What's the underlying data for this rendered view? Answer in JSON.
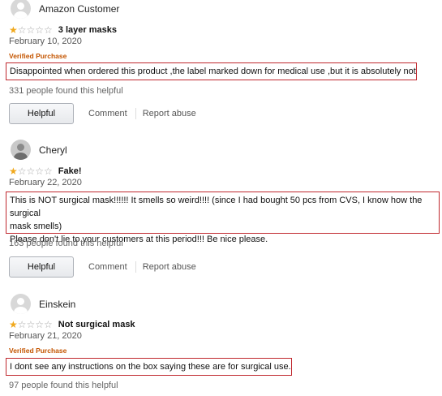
{
  "reviews": [
    {
      "name": "Amazon Customer",
      "stars_filled": 1,
      "title": "3 layer masks",
      "date": "February 10, 2020",
      "verified": "Verified Purchase",
      "body": "Disappointed when ordered this product ,the label marked down for medical use ,but it is absolutely not",
      "helpful_count": "331 people found this helpful",
      "helpful_label": "Helpful",
      "comment_label": "Comment",
      "report_label": "Report abuse"
    },
    {
      "name": "Cheryl",
      "stars_filled": 1,
      "title": "Fake!",
      "date": "February 22, 2020",
      "body_line1": "This is NOT surgical mask!!!!!! It smells so weird!!!! (since I had bought 50 pcs from CVS, I know how the surgical",
      "body_line2": "mask smells)",
      "body_line3": "Please don't lie to your customers at this period!!! Be nice please.",
      "helpful_count": "163 people found this helpful",
      "helpful_label": "Helpful",
      "comment_label": "Comment",
      "report_label": "Report abuse"
    },
    {
      "name": "Einskein",
      "stars_filled": 1,
      "title": "Not surgical mask",
      "date": "February 21, 2020",
      "verified": "Verified Purchase",
      "body": "I dont see any instructions on the box saying these are for surgical use.",
      "helpful_count": "97 people found this helpful"
    }
  ],
  "colors": {
    "star": "#f0a81c",
    "verified": "#c45500",
    "highlight_border": "#c0282e"
  }
}
